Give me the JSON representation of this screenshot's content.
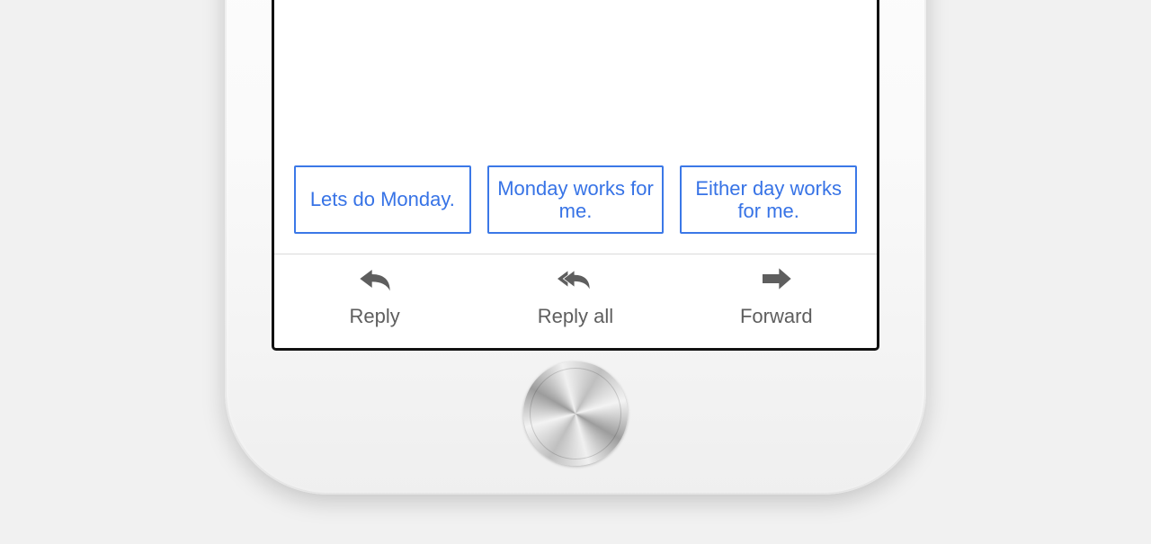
{
  "smart_replies": {
    "items": [
      {
        "label": "Lets do Monday."
      },
      {
        "label": "Monday works for me."
      },
      {
        "label": "Either day works for me."
      }
    ]
  },
  "actions": {
    "reply": {
      "label": "Reply"
    },
    "reply_all": {
      "label": "Reply all"
    },
    "forward": {
      "label": "Forward"
    }
  },
  "colors": {
    "chip_border": "#3b78e7",
    "chip_text": "#3773e6",
    "action_text": "#5e5e5e"
  }
}
